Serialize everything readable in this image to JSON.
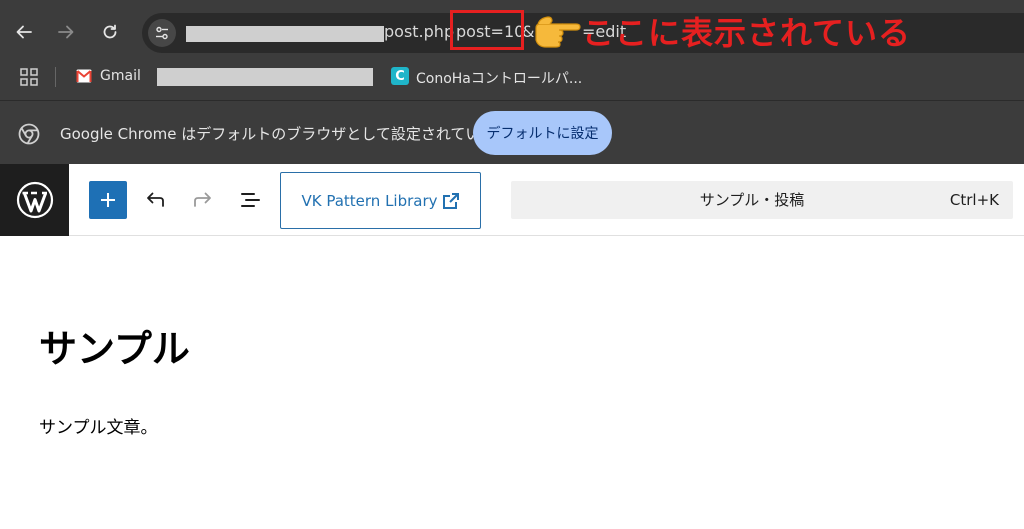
{
  "browser": {
    "url_segments": {
      "path": "post.php",
      "param": "post=10",
      "masked": "&ac",
      "rest": "=edit"
    },
    "annotation": "ここに表示されている",
    "bookmarks": {
      "gmail": "Gmail",
      "conoha": "ConoHaコントロールパ..."
    },
    "infobar": {
      "message": "Google Chrome はデフォルトのブラウザとして設定されていません",
      "button": "デフォルトに設定"
    }
  },
  "editor": {
    "vk_button": "VK Pattern Library",
    "command_bar": {
      "title": "サンプル・投稿",
      "shortcut": "Ctrl+K"
    }
  },
  "post": {
    "title": "サンプル",
    "body": "サンプル文章。"
  },
  "colors": {
    "chrome_bg": "#3c3c3c",
    "annotation": "#e62020",
    "wp_blue": "#1e70b5",
    "infobar_button": "#a8c7fa"
  }
}
